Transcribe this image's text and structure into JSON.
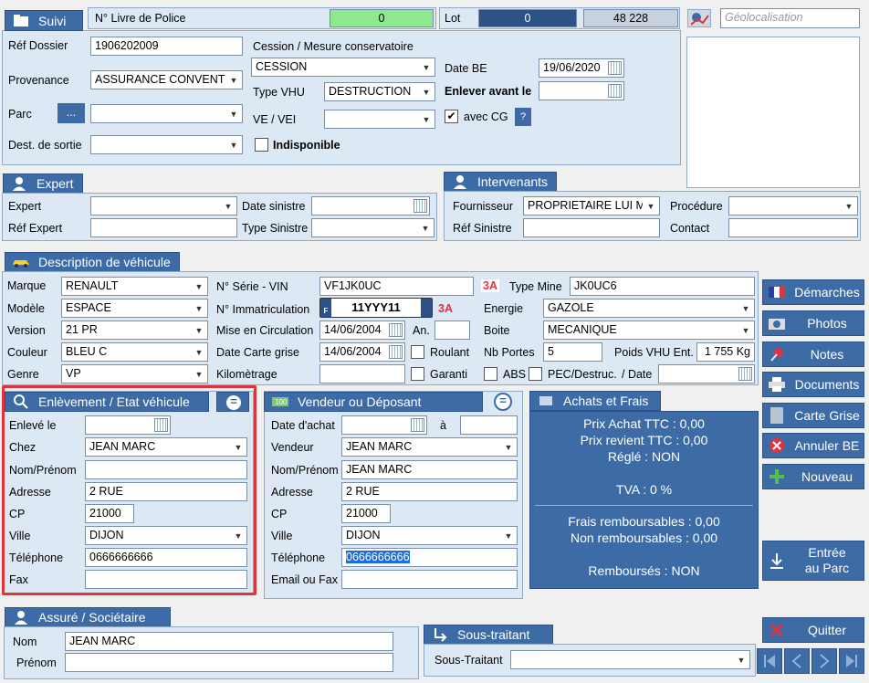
{
  "suivi": {
    "tab": "Suivi",
    "livre_label": "N° Livre de Police",
    "livre_value": "0",
    "lot_label": "Lot",
    "lot_value": "0",
    "lot_total": "48 228",
    "geo_placeholder": "Géolocalisation",
    "ref_dossier_label": "Réf Dossier",
    "ref_dossier": "1906202009",
    "provenance_label": "Provenance",
    "provenance": "ASSURANCE CONVENTIO",
    "parc_label": "Parc",
    "parc_btn": "...",
    "dest_label": "Dest. de sortie",
    "cession_label": "Cession / Mesure conservatoire",
    "cession": "CESSION",
    "type_vhu_label": "Type VHU",
    "type_vhu": "DESTRUCTION",
    "ve_vei_label": "VE / VEI",
    "indispo_label": "Indisponible",
    "date_be_label": "Date BE",
    "date_be": "19/06/2020",
    "enlever_label": "Enlever avant le",
    "avec_cg_label": "avec CG",
    "help": "?"
  },
  "expert": {
    "tab": "Expert",
    "expert_label": "Expert",
    "ref_label": "Réf Expert",
    "date_sinistre_label": "Date sinistre",
    "type_sinistre_label": "Type Sinistre"
  },
  "intervenants": {
    "tab": "Intervenants",
    "fournisseur_label": "Fournisseur",
    "fournisseur": "PROPRIETAIRE LUI ME",
    "ref_sinistre_label": "Réf Sinistre",
    "procedure_label": "Procédure",
    "contact_label": "Contact"
  },
  "vehicule": {
    "tab": "Description de véhicule",
    "marque_label": "Marque",
    "marque": "RENAULT",
    "modele_label": "Modèle",
    "modele": "ESPACE",
    "version_label": "Version",
    "version": "21 PR",
    "couleur_label": "Couleur",
    "couleur": "BLEU C",
    "genre_label": "Genre",
    "genre": "VP",
    "serie_label": "N° Série - VIN",
    "serie": "VF1JK0UC",
    "badge": "3A",
    "immat_label": "N° Immatriculation",
    "immat": "11YYY11",
    "plate_left": "F",
    "mise_label": "Mise en Circulation",
    "mise": "14/06/2004",
    "an_label": "An.",
    "date_cg_label": "Date Carte grise",
    "date_cg": "14/06/2004",
    "roulant_label": "Roulant",
    "km_label": "Kilomètrage",
    "garanti_label": "Garanti",
    "type_mine_label": "Type Mine",
    "type_mine": "JK0UC6",
    "energie_label": "Energie",
    "energie": "GAZOLE",
    "boite_label": "Boite",
    "boite": "MECANIQUE",
    "nb_portes_label": "Nb Portes",
    "nb_portes": "5",
    "poids_label": "Poids VHU Ent.",
    "poids": "1 755 Kg",
    "abs_label": "ABS",
    "pec_label": "PEC/Destruc.",
    "date_label": "/ Date"
  },
  "enlevement": {
    "tab": "Enlèvement / Etat véhicule",
    "enleve_label": "Enlevé le",
    "chez_label": "Chez",
    "chez": "JEAN MARC",
    "nom_label": "Nom/Prénom",
    "adresse_label": "Adresse",
    "adresse": "2 RUE",
    "cp_label": "CP",
    "cp": "21000",
    "ville_label": "Ville",
    "ville": "DIJON",
    "tel_label": "Téléphone",
    "tel": "0666666666",
    "fax_label": "Fax"
  },
  "vendeur": {
    "tab": "Vendeur ou Déposant",
    "date_label": "Date d'achat",
    "a_label": "à",
    "vendeur_label": "Vendeur",
    "vendeur": "JEAN MARC",
    "nom_label": "Nom/Prénom",
    "nom": "JEAN MARC",
    "adresse_label": "Adresse",
    "adresse": "2 RUE",
    "cp_label": "CP",
    "cp": "21000",
    "ville_label": "Ville",
    "ville": "DIJON",
    "tel_label": "Téléphone",
    "tel": "0666666666",
    "email_label": "Email ou Fax"
  },
  "achats": {
    "tab": "Achats et Frais",
    "prix_achat": "Prix Achat TTC :  0,00",
    "prix_revient": "Prix revient TTC :  0,00",
    "regle": "Réglé :  NON",
    "tva": "TVA :  0 %",
    "frais_remb": "Frais remboursables :  0,00",
    "non_remb": "Non remboursables :  0,00",
    "rembourses": "Remboursés :  NON"
  },
  "assure": {
    "tab": "Assuré / Sociétaire",
    "nom_label": "Nom",
    "nom": "JEAN MARC",
    "prenom_label": "Prénom"
  },
  "sous": {
    "tab": "Sous-traitant",
    "label": "Sous-Traitant"
  },
  "side": {
    "demarches": "Démarches",
    "photos": "Photos",
    "notes": "Notes",
    "documents": "Documents",
    "carte_grise": "Carte Grise",
    "annuler": "Annuler BE",
    "nouveau": "Nouveau",
    "entree1": "Entrée",
    "entree2": "au Parc",
    "quitter": "Quitter"
  },
  "colors": {
    "accent": "#3d6ba6",
    "highlight": "#e0343c",
    "green": "#8fe88f"
  }
}
